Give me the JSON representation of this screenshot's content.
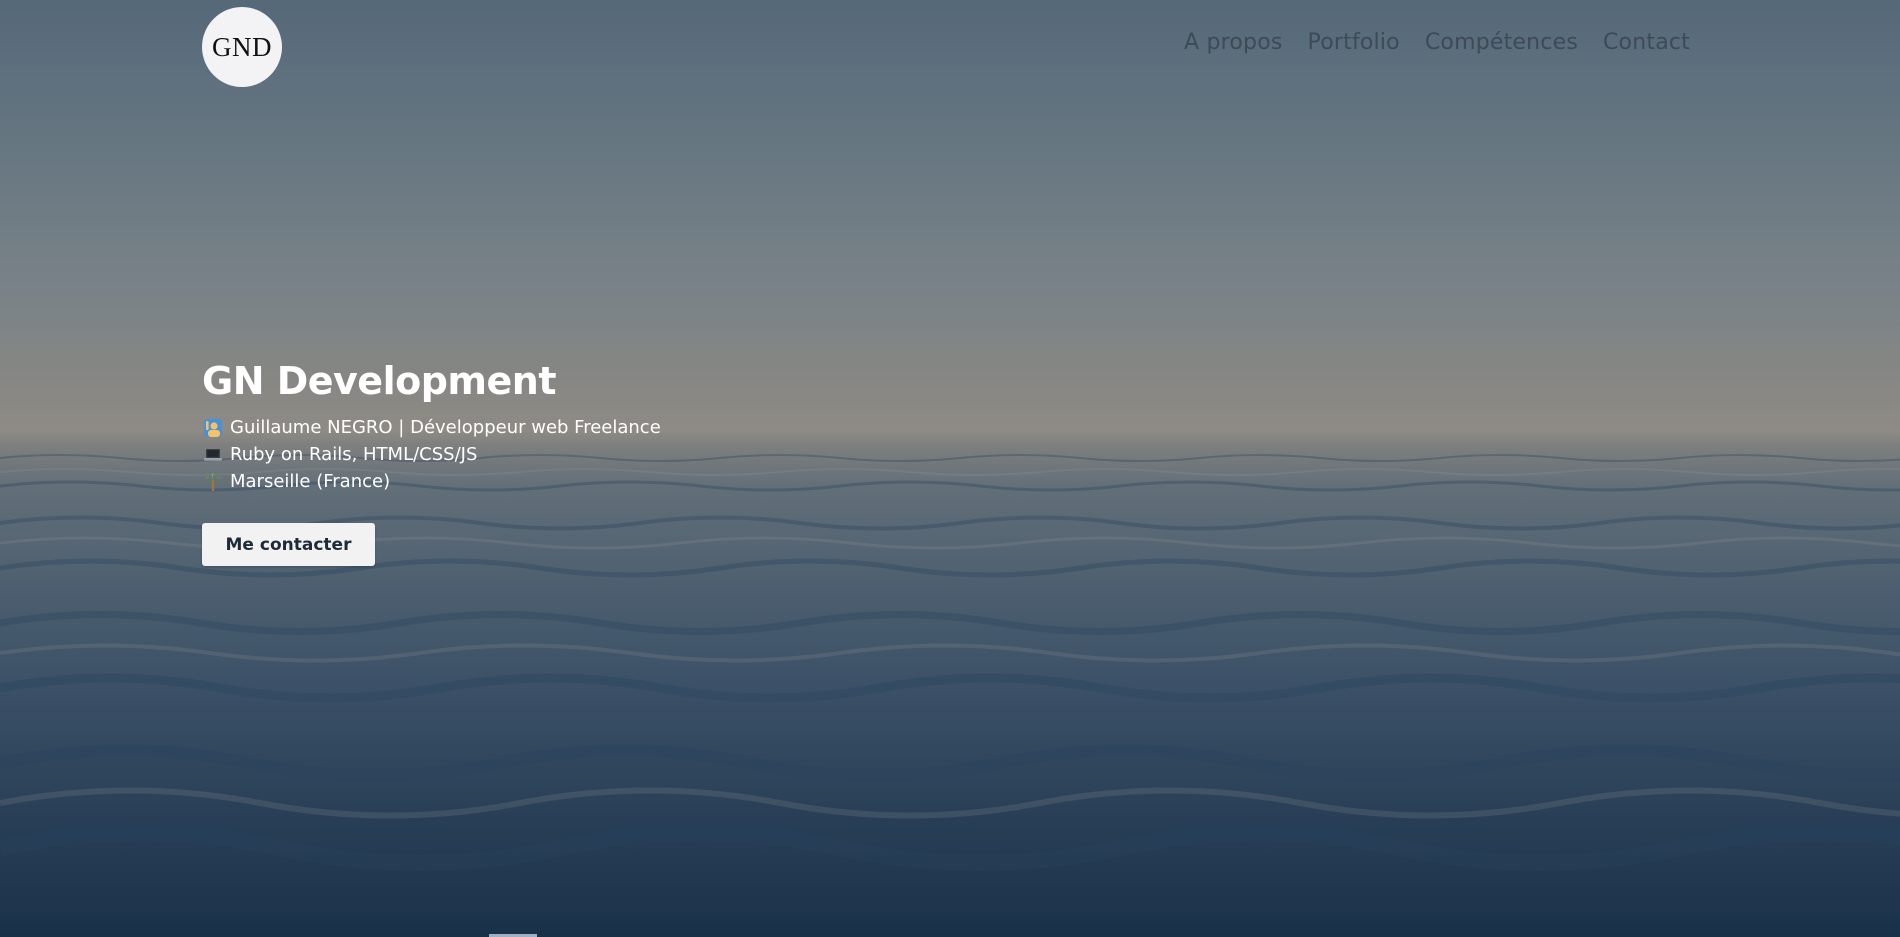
{
  "brand": {
    "logo_text": "GND"
  },
  "nav": {
    "items": [
      {
        "label": "A propos"
      },
      {
        "label": "Portfolio"
      },
      {
        "label": "Compétences"
      },
      {
        "label": "Contact"
      }
    ]
  },
  "hero": {
    "title": "GN Development",
    "lines": [
      {
        "icon": "person-raising-hand-icon",
        "text": "Guillaume NEGRO | Développeur web Freelance"
      },
      {
        "icon": "laptop-icon",
        "text": "Ruby on Rails, HTML/CSS/JS"
      },
      {
        "icon": "palm-tree-icon",
        "text": "Marseille (France)"
      }
    ],
    "cta_label": "Me contacter"
  },
  "colors": {
    "nav_text": "#3e4a55",
    "button_bg": "#f2f2f2",
    "button_text": "#1d2a3a"
  }
}
